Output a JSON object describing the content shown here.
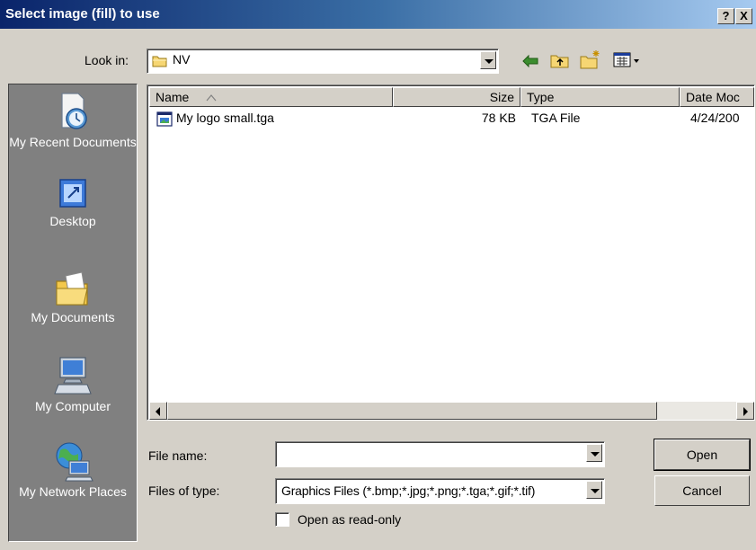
{
  "dialog": {
    "title": "Select image (fill) to use",
    "help_label": "?",
    "close_label": "X"
  },
  "toolbar": {
    "look_in_label": "Look in:",
    "look_in_value": "NV",
    "back_icon": "back-arrow-icon",
    "up_icon": "up-folder-icon",
    "new_folder_icon": "new-folder-icon",
    "view_icon": "view-menu-icon"
  },
  "places": [
    {
      "label": "My Recent Documents",
      "icon": "recent-documents-icon"
    },
    {
      "label": "Desktop",
      "icon": "desktop-icon"
    },
    {
      "label": "My Documents",
      "icon": "my-documents-icon"
    },
    {
      "label": "My Computer",
      "icon": "my-computer-icon"
    },
    {
      "label": "My Network Places",
      "icon": "network-places-icon"
    }
  ],
  "filelist": {
    "columns": [
      "Name",
      "Size",
      "Type",
      "Date Moc"
    ],
    "rows": [
      {
        "name": "My logo small.tga",
        "size": "78 KB",
        "type": "TGA File",
        "date": "4/24/200"
      }
    ]
  },
  "form": {
    "filename_label": "File name:",
    "filename_value": "",
    "filetype_label": "Files of type:",
    "filetype_value": "Graphics Files (*.bmp;*.jpg;*.png;*.tga;*.gif;*.tif)",
    "readonly_label": "Open as read-only",
    "readonly_checked": false,
    "open_label": "Open",
    "cancel_label": "Cancel"
  },
  "colors": {
    "titlebar_start": "#0a246a",
    "titlebar_end": "#a6caf0",
    "face": "#d4d0c8",
    "places_bg": "#808080"
  }
}
